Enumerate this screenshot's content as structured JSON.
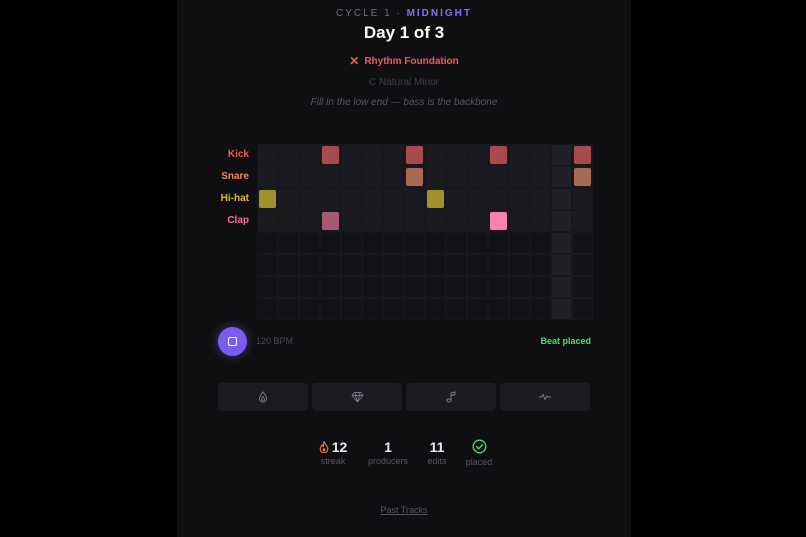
{
  "header": {
    "cycle_prefix": "CYCLE 1 · ",
    "cycle_theme": "MIDNIGHT",
    "day_title": "Day 1 of 3",
    "challenge_name": "Rhythm Foundation",
    "key_label": "C Natural Minor",
    "hint": "Fill in the low end — bass is the backbone"
  },
  "sequencer": {
    "steps": 16,
    "rows": [
      {
        "label": "Kick",
        "color": "#ef5a5a",
        "note_color": "#a84b4b",
        "steps": [
          3,
          7,
          11,
          15
        ]
      },
      {
        "label": "Snare",
        "color": "#f08a5a",
        "note_color": "#a86a52",
        "steps": [
          7,
          15
        ]
      },
      {
        "label": "Hi-hat",
        "color": "#e0b93a",
        "note_color": "#a38f2c",
        "steps": [
          0,
          8
        ]
      },
      {
        "label": "Clap",
        "color": "#f06e9a",
        "note_color": "#a55a72",
        "steps": [
          3
        ],
        "bright_steps": [
          11
        ],
        "bright_color": "#f882a9"
      }
    ],
    "empty_rows": 4,
    "highlight_step": 14
  },
  "transport": {
    "bpm_label": "120 BPM",
    "status": "Beat placed"
  },
  "tools": [
    {
      "icon": "drop-icon"
    },
    {
      "icon": "diamond-icon"
    },
    {
      "icon": "music-note-icon"
    },
    {
      "icon": "wave-icon"
    }
  ],
  "stats": {
    "streak_value": "12",
    "streak_label": "streak",
    "producers_value": "1",
    "producers_label": "producers",
    "edits_value": "11",
    "edits_label": "edits",
    "placed_label": "placed"
  },
  "footer": {
    "past_tracks": "Past Tracks"
  }
}
